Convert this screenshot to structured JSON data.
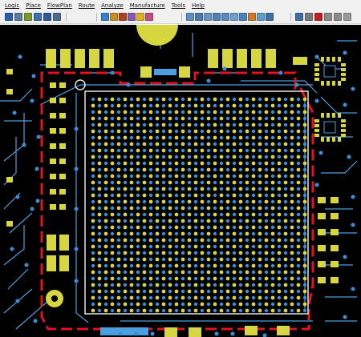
{
  "menu": [
    {
      "id": "logic",
      "label": "Logic"
    },
    {
      "id": "place",
      "label": "Place"
    },
    {
      "id": "flowplan",
      "label": "FlowPlan"
    },
    {
      "id": "route",
      "label": "Route"
    },
    {
      "id": "analyze",
      "label": "Analyze"
    },
    {
      "id": "manufacture",
      "label": "Manufacture"
    },
    {
      "id": "tools",
      "label": "Tools"
    },
    {
      "id": "help",
      "label": "Help"
    }
  ],
  "toolbar": {
    "left_group": [
      "grid-icon",
      "layers-icon",
      "place-icon",
      "route-icon",
      "gallery-icon",
      "window-icon"
    ],
    "middle_group": [
      "globe-icon",
      "add-part-icon",
      "bus-icon",
      "pen-icon",
      "sun-icon",
      "paint-icon"
    ],
    "view_group": [
      "zoom-fit-icon",
      "zoom-window-icon",
      "zoom-in-icon",
      "zoom-out-icon",
      "zoom-prev-icon",
      "zoom-area-icon",
      "pan-icon",
      "highlight-icon",
      "display-icon",
      "color-icon"
    ],
    "right_group": [
      "move-icon",
      "rotate-icon",
      "delete-icon",
      "undo-icon",
      "redo-icon",
      "more-icon"
    ]
  },
  "colors": {
    "board_background": "#000000",
    "pad_yellow": "#d6d640",
    "via_blue": "#3b8fd6",
    "trace_blue": "#4a9fe0",
    "keepout_red": "#e0141e",
    "outline_white": "#e6e6e6",
    "toolbar_background": "#f0f0f0"
  },
  "board": {
    "component": "BGA package",
    "ball_grid_rows": 34,
    "ball_grid_columns": 34
  }
}
